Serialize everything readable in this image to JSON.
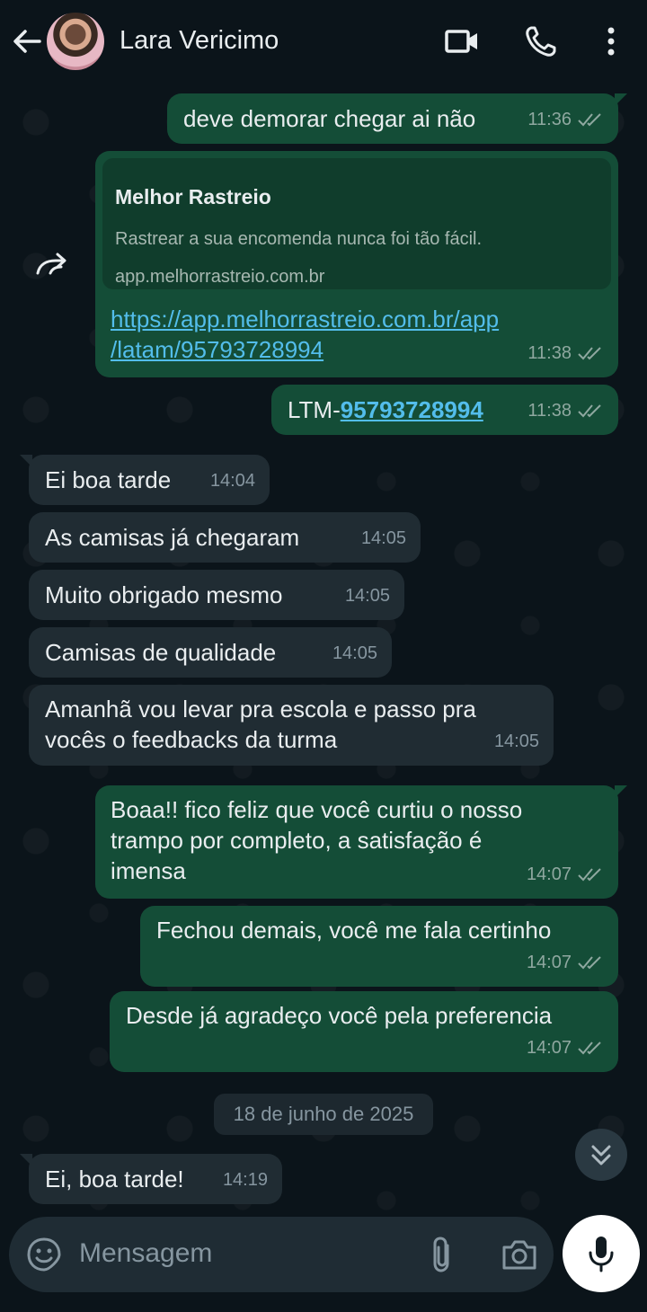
{
  "header": {
    "contact_name": "Lara Vericimo",
    "icons": [
      "back-arrow-icon",
      "video-call-icon",
      "voice-call-icon",
      "more-options-icon"
    ]
  },
  "messages": [
    {
      "dir": "out",
      "text": "deve demorar chegar ai não",
      "time": "11:36"
    },
    {
      "dir": "out",
      "type": "link",
      "preview_title": "Melhor Rastreio",
      "preview_desc": "Rastrear a sua encomenda nunca foi tão fácil.",
      "preview_domain": "app.melhorrastreio.com.br",
      "link_line1": "https://app.melhorrastreio.com.br/app",
      "link_line2": "/latam/95793728994",
      "time": "11:38"
    },
    {
      "dir": "out",
      "prefix": "LTM-",
      "link": "95793728994",
      "time": "11:38"
    },
    {
      "dir": "in",
      "text": "Ei boa tarde",
      "time": "14:04"
    },
    {
      "dir": "in",
      "text": "As camisas já chegaram",
      "time": "14:05"
    },
    {
      "dir": "in",
      "text": "Muito obrigado mesmo",
      "time": "14:05"
    },
    {
      "dir": "in",
      "text": "Camisas de qualidade",
      "time": "14:05"
    },
    {
      "dir": "in",
      "line1": "Amanhã vou levar pra escola e passo pra",
      "line2": "vocês o feedbacks da turma",
      "time": "14:05"
    },
    {
      "dir": "out",
      "line1": "Boaa!! fico feliz que você curtiu o nosso",
      "line2": "trampo por completo, a satisfação é",
      "line3": "imensa",
      "time": "14:07"
    },
    {
      "dir": "out",
      "text": "Fechou demais, você me fala certinho",
      "time": "14:07"
    },
    {
      "dir": "out",
      "text": "Desde já agradeço você pela preferencia",
      "time": "14:07"
    },
    {
      "dir": "in",
      "text": "Ei, boa tarde!",
      "time": "14:19"
    }
  ],
  "date_separator": "18 de junho de 2025",
  "composer": {
    "placeholder": "Mensagem",
    "icons": [
      "emoji-icon",
      "attach-icon",
      "camera-icon",
      "mic-icon"
    ]
  },
  "colors": {
    "background": "#0b141a",
    "outgoing_bubble": "#144d37",
    "incoming_bubble": "#202c33",
    "link": "#53bdeb",
    "read_ticks": "#8fa8a0"
  }
}
